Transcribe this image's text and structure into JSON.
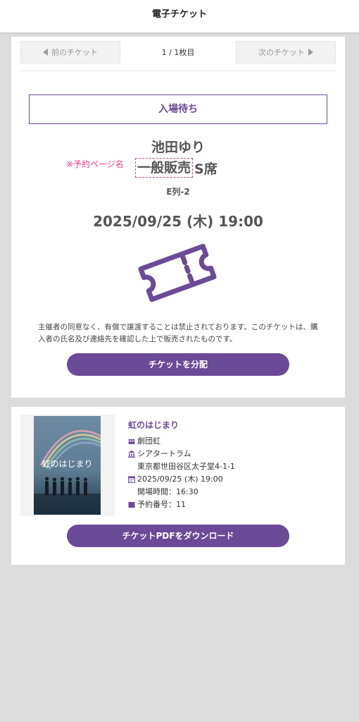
{
  "app": {
    "title": "電子チケット"
  },
  "nav": {
    "prev_label": "前のチケット",
    "next_label": "次のチケット",
    "pager": "1 / 1枚目"
  },
  "ticket": {
    "status": "入場待ち",
    "holder": "池田ゆり",
    "note": "※予約ページ名",
    "sale_type": "一般販売",
    "seat_type": "S席",
    "seat": "E列-2",
    "datetime": "2025/09/25 (木) 19:00",
    "disclaimer": "主催者の同意なく、有償で譲渡することは禁止されております。このチケットは、購入者の氏名及び連絡先を確認した上で販売されたものです。",
    "distribute_label": "チケットを分配"
  },
  "event": {
    "title": "虹のはじまり",
    "poster_title": "虹のはじまり",
    "organizer": "劇団虹",
    "venue": "シアタートラム",
    "address": "東京都世田谷区太子堂4-1-1",
    "date": "2025/09/25 (木) 19:00",
    "open_time": "開場時間：16:30",
    "reservation": "予約番号：11",
    "download_label": "チケットPDFをダウンロード"
  },
  "icons": {
    "prev": "triangle-left-icon",
    "next": "triangle-right-icon",
    "ticket": "ticket-icon",
    "organizer": "group-icon",
    "venue": "building-icon",
    "date": "calendar-icon",
    "reservation": "square-icon"
  },
  "colors": {
    "accent": "#6b4a97",
    "note": "#e0428a",
    "background": "#dcdcdc"
  }
}
